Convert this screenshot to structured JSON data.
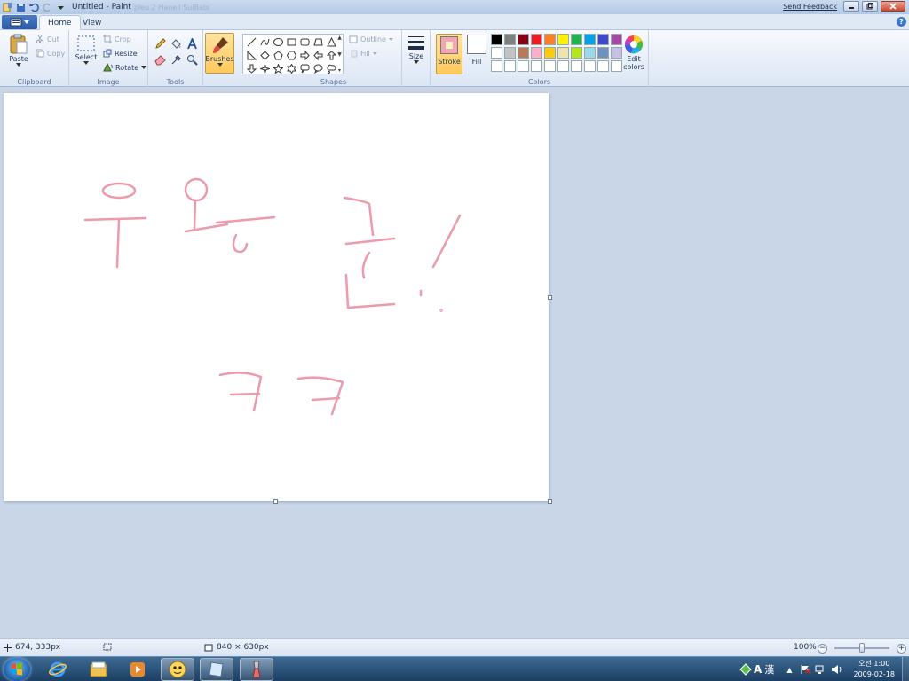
{
  "window": {
    "title": "Untitled - Paint",
    "title_ghost": "pleu 2 Hanell SulBabi",
    "send_feedback": "Send Feedback"
  },
  "tabs": [
    {
      "label": "Home"
    },
    {
      "label": "View"
    }
  ],
  "ribbon": {
    "clipboard": {
      "label": "Clipboard",
      "paste": "Paste",
      "cut": "Cut",
      "copy": "Copy"
    },
    "image": {
      "label": "Image",
      "select": "Select",
      "crop": "Crop",
      "resize": "Resize",
      "rotate": "Rotate"
    },
    "tools": {
      "label": "Tools"
    },
    "brushes": {
      "label": "Brushes"
    },
    "shapes": {
      "label": "Shapes",
      "outline": "Outline",
      "fill": "Fill"
    },
    "size": {
      "label": "Size"
    },
    "colors": {
      "label": "Colors",
      "stroke": "Stroke",
      "fill": "Fill",
      "edit": "Edit colors",
      "stroke_color": "#f2a5b5",
      "fill_color": "#ffffff",
      "palette": [
        "#000000",
        "#7f7f7f",
        "#880015",
        "#ed1c24",
        "#ff7f27",
        "#fff200",
        "#22b14c",
        "#00a2e8",
        "#3f48cc",
        "#a349a4",
        "#ffffff",
        "#c3c3c3",
        "#b97a57",
        "#ffaec9",
        "#ffc90e",
        "#efe4b0",
        "#b5e61d",
        "#99d9ea",
        "#7092be",
        "#c8bfe7",
        "#ffffff",
        "#ffffff",
        "#ffffff",
        "#ffffff",
        "#ffffff",
        "#ffffff",
        "#ffffff",
        "#ffffff",
        "#ffffff",
        "#ffffff"
      ]
    }
  },
  "status": {
    "cursor_pos": "674, 333px",
    "canvas_size": "840 × 630px",
    "zoom": "100%"
  },
  "taskbar": {
    "clock_time": "오전 1:00",
    "clock_date": "2009-02-18",
    "ime_mode": "A",
    "ime_hanja": "漢"
  },
  "drawing": {
    "stroke_color": "#ec9aac"
  }
}
